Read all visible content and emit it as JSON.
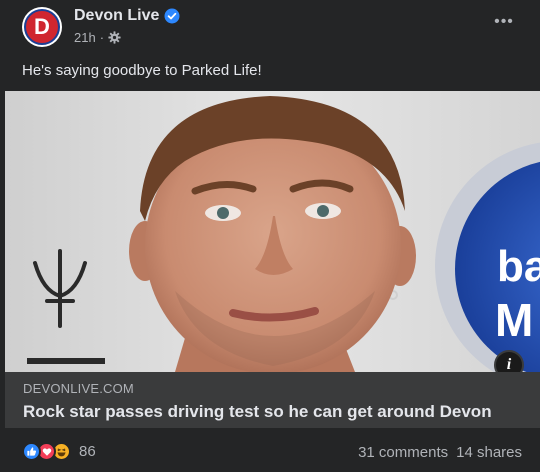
{
  "header": {
    "page_name": "Devon Live",
    "avatar_letter": "D",
    "timestamp": "21h",
    "separator": "·",
    "audience_icon": "gear-icon",
    "verified_icon": "verified-badge-icon",
    "more_icon": "more-options-icon",
    "more_label": "•••"
  },
  "post": {
    "caption": "He's saying goodbye to Parked Life!"
  },
  "image": {
    "info_icon": "info-icon",
    "info_label": "i"
  },
  "link_preview": {
    "domain": "DEVONLIVE.COM",
    "title": "Rock star passes driving test so he can get around Devon"
  },
  "footer": {
    "reaction_icons": [
      "like-icon",
      "love-icon",
      "haha-icon"
    ],
    "reaction_count": "86",
    "comments": "31 comments",
    "shares": "14 shares"
  },
  "colors": {
    "background": "#242526",
    "link_box": "#3a3b3c",
    "primary_text": "#e4e6eb",
    "secondary_text": "#b0b3b8",
    "verified_blue": "#2d88ff",
    "brand_red": "#d0262f"
  }
}
